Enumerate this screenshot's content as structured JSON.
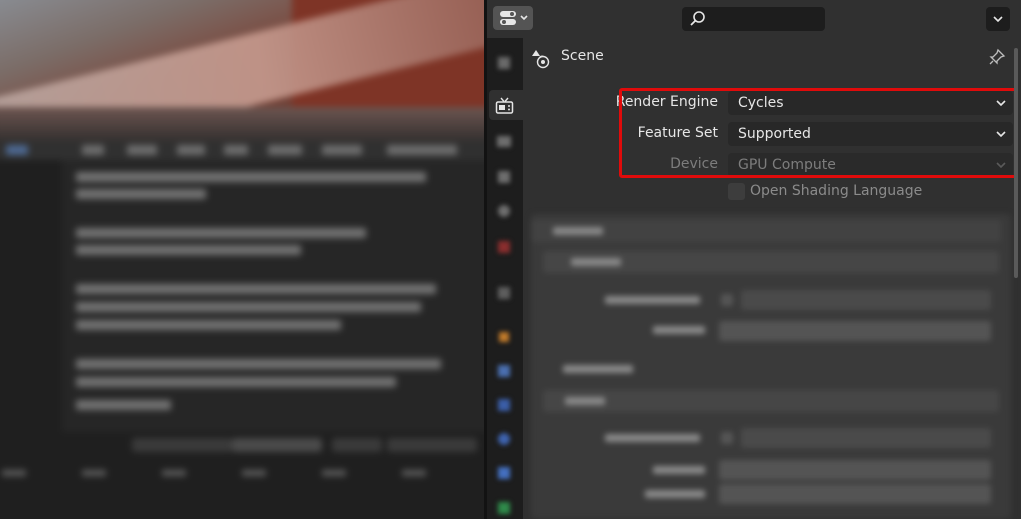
{
  "properties": {
    "context_label": "Scene",
    "render_engine": {
      "label": "Render Engine",
      "value": "Cycles"
    },
    "feature_set": {
      "label": "Feature Set",
      "value": "Supported"
    },
    "device": {
      "label": "Device",
      "value": "GPU Compute"
    },
    "open_shading_language": {
      "label": "Open Shading Language",
      "checked": false
    }
  },
  "highlight_color": "#e00b0b",
  "icons": {
    "editor_type": "properties-editor-icon",
    "search": "search-icon",
    "options": "chevron-down-icon",
    "context": "scene-icon",
    "pin": "pin-icon",
    "tabs": [
      "tool-icon",
      "render-icon",
      "output-icon",
      "view-layer-icon",
      "scene-icon",
      "world-icon",
      "collection-icon",
      "object-icon",
      "modifier-icon",
      "particles-icon",
      "physics-icon",
      "constraints-icon",
      "data-icon"
    ]
  }
}
